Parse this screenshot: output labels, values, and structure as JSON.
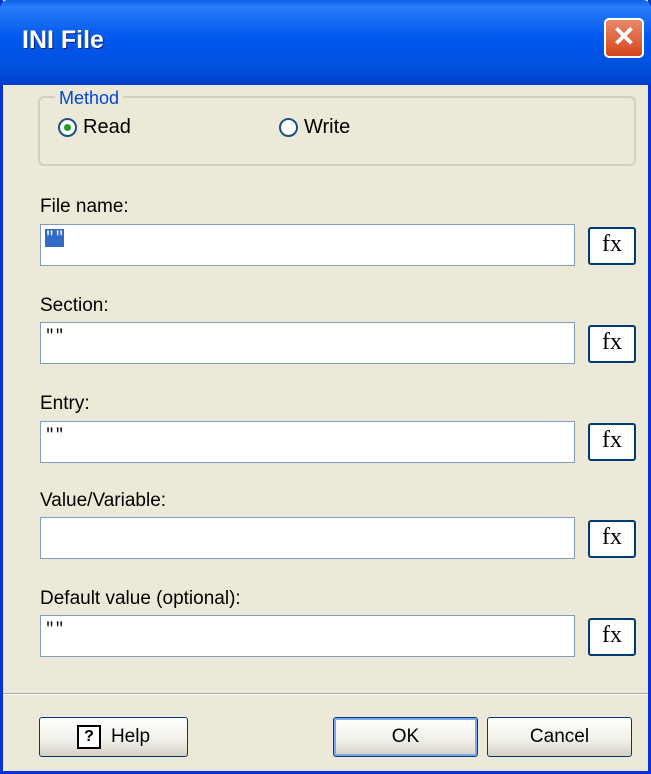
{
  "window": {
    "title": "INI File",
    "close_glyph": "✕"
  },
  "method": {
    "legend": "Method",
    "options": [
      {
        "label": "Read",
        "checked": true
      },
      {
        "label": "Write",
        "checked": false
      }
    ]
  },
  "fields": [
    {
      "label": "File name:",
      "value": "\"\"",
      "selected": true
    },
    {
      "label": "Section:",
      "value": "\"\"",
      "selected": false
    },
    {
      "label": "Entry:",
      "value": "\"\"",
      "selected": false
    },
    {
      "label": "Value/Variable:",
      "value": "",
      "selected": false
    },
    {
      "label": "Default value (optional):",
      "value": "\"\"",
      "selected": false
    }
  ],
  "fx_label": "fx",
  "buttons": {
    "help": "Help",
    "help_icon_glyph": "?",
    "ok": "OK",
    "cancel": "Cancel"
  },
  "colors": {
    "titlebar": "#0058ee",
    "face": "#ece9d8",
    "legend": "#0046d5",
    "close": "#d5461c"
  }
}
